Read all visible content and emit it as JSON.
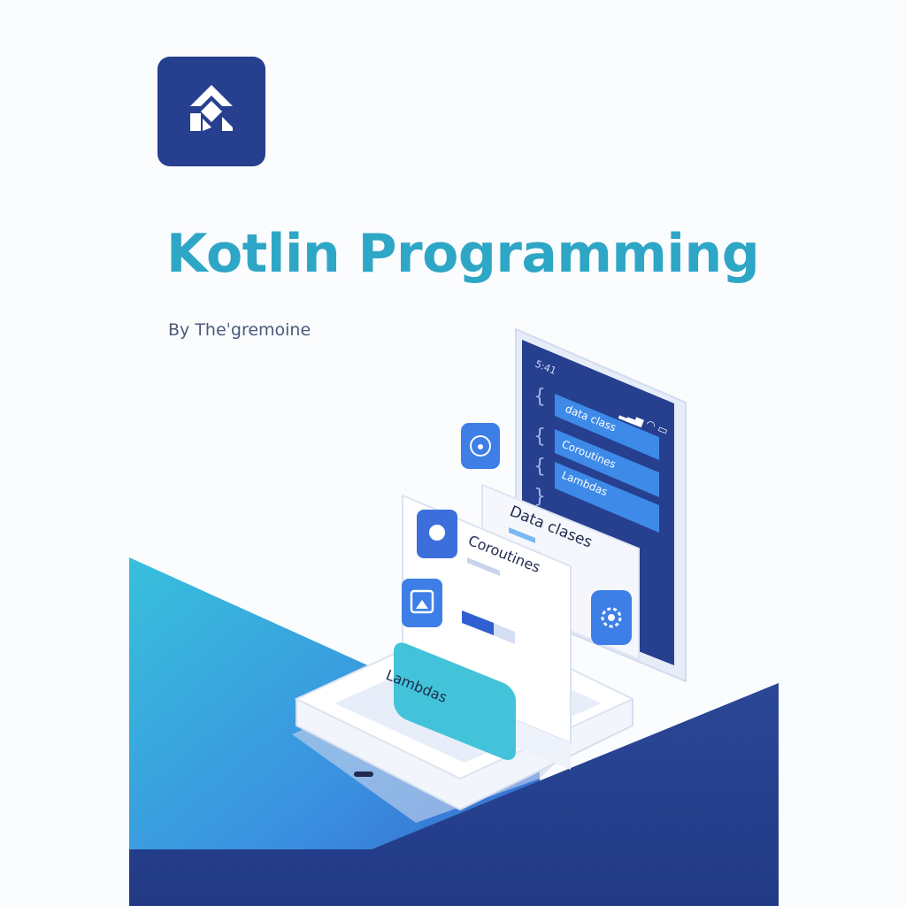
{
  "book": {
    "title": "Kotlin Programming",
    "author": "By Theˈgremoine"
  },
  "logo": {
    "icon": "kotlin-k-logo-icon",
    "background": "#263f8f"
  },
  "illustration": {
    "phone_status": "5:41",
    "code_chips": [
      "data class",
      "Coroutines",
      "Lambdas"
    ],
    "cards": {
      "data_classes": "Data clases",
      "coroutines": "Coroutines",
      "lambdas": "Lambdas"
    }
  },
  "colors": {
    "title": "#2ea6c6",
    "navy": "#263f8f",
    "teal": "#36b8d8",
    "accent_blue": "#3d7fe6"
  }
}
